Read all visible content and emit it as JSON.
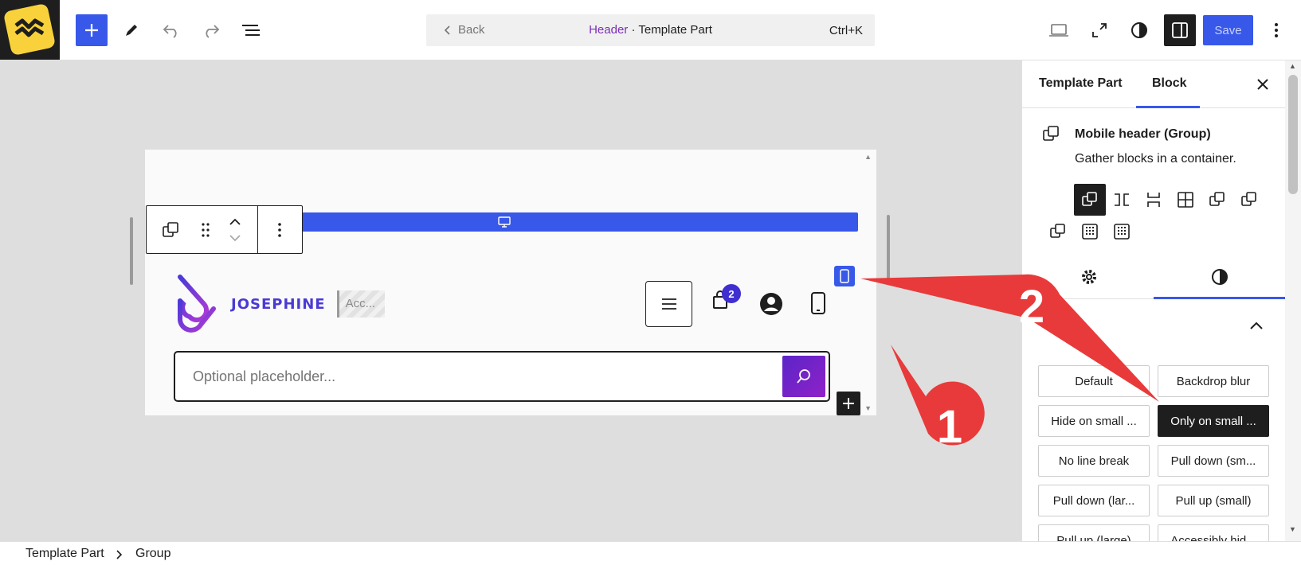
{
  "topbar": {
    "back_label": "Back",
    "title_highlight": "Header",
    "title_rest": " · Template Part",
    "shortcut": "Ctrl+K",
    "save_label": "Save"
  },
  "canvas": {
    "brand_name": "JOSEPHINE",
    "acc_text": "Acc...",
    "cart_count": "2",
    "search_placeholder": "Optional placeholder..."
  },
  "sidebar": {
    "tabs": [
      {
        "label": "Template Part",
        "active": false
      },
      {
        "label": "Block",
        "active": true
      }
    ],
    "block_title": "Mobile header (Group)",
    "block_description": "Gather blocks in a container.",
    "block_styles": [
      {
        "label": "Default",
        "active": false
      },
      {
        "label": "Backdrop blur",
        "active": false
      },
      {
        "label": "Hide on small ...",
        "active": false
      },
      {
        "label": "Only on small ...",
        "active": true
      },
      {
        "label": "No line break",
        "active": false
      },
      {
        "label": "Pull down (sm...",
        "active": false
      },
      {
        "label": "Pull down (lar...",
        "active": false
      },
      {
        "label": "Pull up (small)",
        "active": false
      },
      {
        "label": "Pull up (large)",
        "active": false
      },
      {
        "label": "Accessibly hid...",
        "active": false
      }
    ]
  },
  "breadcrumb": {
    "items": [
      "Template Part",
      "Group"
    ]
  },
  "annotations": {
    "marker_1": "1",
    "marker_2": "2",
    "arrow_color": "#e83a3a"
  },
  "colors": {
    "accent": "#3858e9",
    "brand_purple": "#4a3ad4",
    "dark": "#1e1e1e",
    "canvas_bg": "#dedede",
    "logo_yellow": "#f9d23b"
  }
}
